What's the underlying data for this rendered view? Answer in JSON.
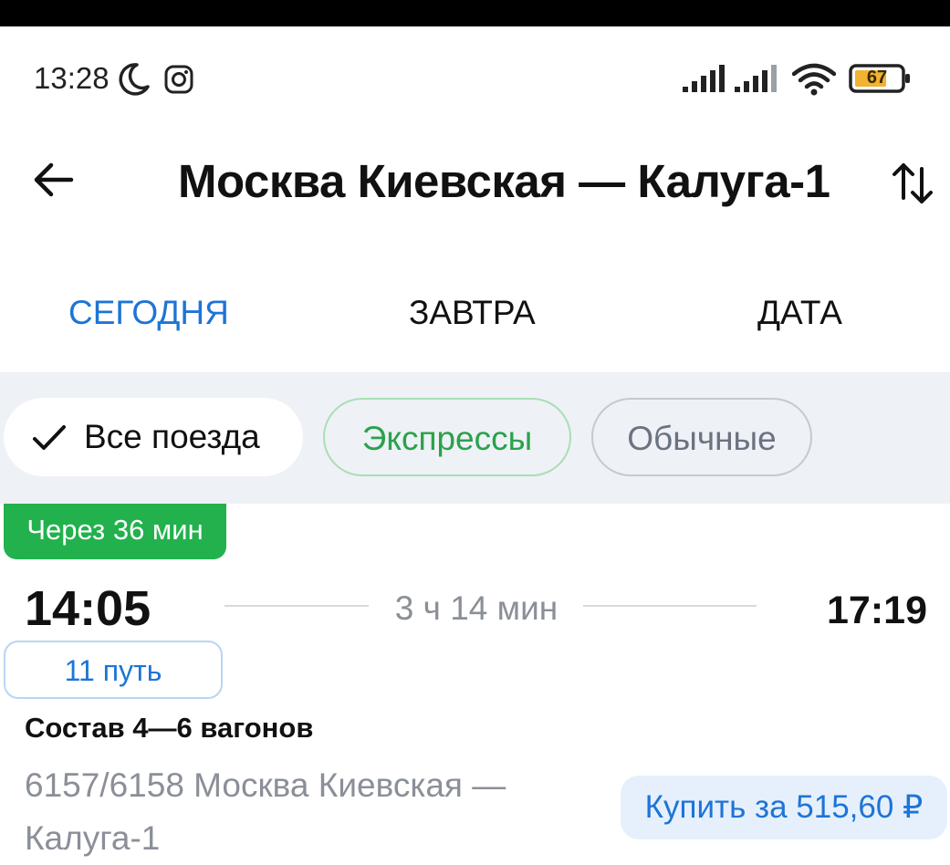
{
  "status_bar": {
    "time": "13:28",
    "battery_level": "67",
    "icons": [
      "moon-icon",
      "instagram-icon",
      "signal-icon",
      "signal-icon",
      "wifi-icon",
      "battery-icon"
    ]
  },
  "header": {
    "title": "Москва Киевская — Калуга-1",
    "back_icon": "arrow-left-icon",
    "swap_icon": "swap-vertical-icon"
  },
  "tabs": [
    {
      "label": "СЕГОДНЯ",
      "active": true
    },
    {
      "label": "ЗАВТРА",
      "active": false
    },
    {
      "label": "ДАТА",
      "active": false
    }
  ],
  "filters": {
    "all": {
      "label": "Все поезда",
      "selected": true
    },
    "express": {
      "label": "Экспрессы",
      "selected": false
    },
    "regular": {
      "label": "Обычные",
      "selected": false
    }
  },
  "train": {
    "badge": "Через 36 мин",
    "departure": "14:05",
    "duration": "3 ч 14 мин",
    "arrival": "17:19",
    "track": "11 путь",
    "consist": "Состав 4—6 вагонов",
    "route": "6157/6158 Москва Киевская — Калуга-1",
    "buy_label": "Купить за 515,60 ₽"
  },
  "colors": {
    "accent_blue": "#1e74d6",
    "express_green": "#2aa24a",
    "badge_green": "#22b14c",
    "filter_bg": "#eef1f6"
  }
}
